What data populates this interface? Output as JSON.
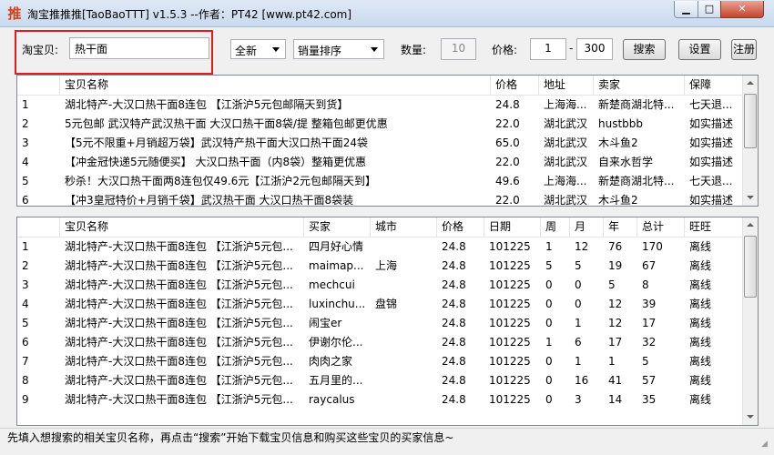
{
  "window": {
    "title": "淘宝推推推[TaoBaoTTT] v1.5.3 --作者：PT42 [www.pt42.com]",
    "app_icon": "推",
    "minimize_glyph": "▁",
    "maximize_glyph": "□",
    "close_glyph": "✕"
  },
  "toolbar": {
    "search_label": "淘宝贝:",
    "search_value": "热干面",
    "filter_select": "全新",
    "sort_select": "销量排序",
    "qty_label": "数量:",
    "qty_value": "10",
    "price_label": "价格:",
    "price_min": "1",
    "price_sep": "-",
    "price_max": "300",
    "search_button": "搜索",
    "settings_button": "设置",
    "register_button": "注册"
  },
  "items_grid": {
    "columns": [
      "",
      "宝贝名称",
      "价格",
      "地址",
      "卖家",
      "保障"
    ],
    "rows": [
      [
        "1",
        "湖北特产-大汉口热干面8连包 【江浙沪5元包邮隔天到货】",
        "24.8",
        "上海海...",
        "新楚商湖北特...",
        "七天退..."
      ],
      [
        "2",
        "5元包邮 武汉特产武汉热干面 大汉口热干面8袋/提 整箱包邮更优惠",
        "22.0",
        "湖北武汉",
        "hustbbb",
        "如实描述"
      ],
      [
        "3",
        "【5元不限重+月销超万袋】武汉特产热干面大汉口热干面24袋",
        "65.0",
        "湖北武汉",
        "木斗鱼2",
        "如实描述"
      ],
      [
        "4",
        "【冲金冠快递5元随便买】 大汉口热干面（内8袋）整箱更优惠",
        "22.0",
        "湖北武汉",
        "自来水哲学",
        "如实描述"
      ],
      [
        "5",
        "秒杀！大汉口热干面两8连包仅49.6元【江浙沪2元包邮隔天到】",
        "49.6",
        "上海海...",
        "新楚商湖北特...",
        "七天退..."
      ],
      [
        "6",
        "【冲3皇冠特价+月销千袋】武汉热干面 大汉口热干面8袋装",
        "22.0",
        "湖北武汉",
        "木斗鱼2",
        "如实描述"
      ]
    ]
  },
  "buyers_grid": {
    "columns": [
      "",
      "宝贝名称",
      "买家",
      "城市",
      "价格",
      "日期",
      "周",
      "月",
      "年",
      "总计",
      "旺旺"
    ],
    "rows": [
      [
        "1",
        "湖北特产-大汉口热干面8连包 【江浙沪5元包...",
        "四月好心情",
        "",
        "24.8",
        "101225",
        "1",
        "12",
        "76",
        "170",
        "离线"
      ],
      [
        "2",
        "湖北特产-大汉口热干面8连包 【江浙沪5元包...",
        "maimap...",
        "上海",
        "24.8",
        "101225",
        "5",
        "5",
        "19",
        "67",
        "离线"
      ],
      [
        "3",
        "湖北特产-大汉口热干面8连包 【江浙沪5元包...",
        "mechcui",
        "",
        "24.8",
        "101225",
        "0",
        "0",
        "5",
        "8",
        "离线"
      ],
      [
        "4",
        "湖北特产-大汉口热干面8连包 【江浙沪5元包...",
        "luxinchu...",
        "盘锦",
        "24.8",
        "101225",
        "0",
        "0",
        "12",
        "39",
        "离线"
      ],
      [
        "5",
        "湖北特产-大汉口热干面8连包 【江浙沪5元包...",
        "闹宝er",
        "",
        "24.8",
        "101225",
        "0",
        "1",
        "12",
        "17",
        "离线"
      ],
      [
        "6",
        "湖北特产-大汉口热干面8连包 【江浙沪5元包...",
        "伊谢尔伦...",
        "",
        "24.8",
        "101225",
        "1",
        "6",
        "17",
        "32",
        "离线"
      ],
      [
        "7",
        "湖北特产-大汉口热干面8连包 【江浙沪5元包...",
        "肉肉之家",
        "",
        "24.8",
        "101225",
        "0",
        "1",
        "1",
        "5",
        "离线"
      ],
      [
        "8",
        "湖北特产-大汉口热干面8连包 【江浙沪5元包...",
        "五月里的...",
        "",
        "24.8",
        "101225",
        "0",
        "16",
        "41",
        "57",
        "离线"
      ],
      [
        "9",
        "湖北特产-大汉口热干面8连包 【江浙沪5元包...",
        "raycalus",
        "",
        "24.8",
        "101225",
        "0",
        "3",
        "14",
        "35",
        "离线"
      ]
    ]
  },
  "statusbar": {
    "text": "先填入想搜索的相关宝贝名称，再点击“搜索”开始下载宝贝信息和购买这些宝贝的买家信息~"
  }
}
